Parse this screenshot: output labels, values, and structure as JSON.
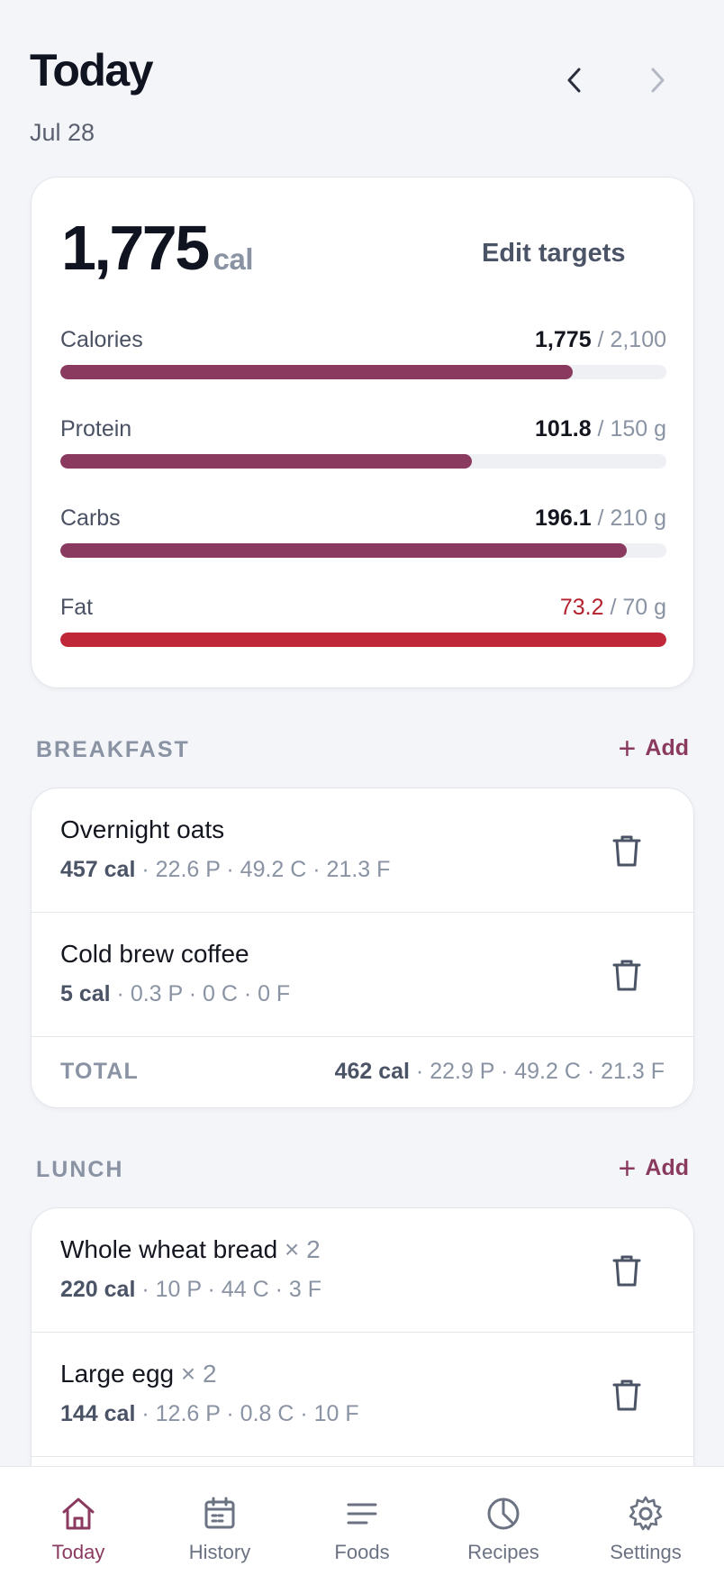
{
  "header": {
    "title": "Today",
    "date": "Jul 28"
  },
  "summary": {
    "calories_big": "1,775",
    "calories_unit": "cal",
    "edit_targets_label": "Edit targets",
    "macros": [
      {
        "label": "Calories",
        "current": "1,775",
        "target": "/ 2,100",
        "progress": 0.845,
        "over": false
      },
      {
        "label": "Protein",
        "current": "101.8",
        "target": "/ 150 g",
        "progress": 0.679,
        "over": false
      },
      {
        "label": "Carbs",
        "current": "196.1",
        "target": "/ 210 g",
        "progress": 0.934,
        "over": false
      },
      {
        "label": "Fat",
        "current": "73.2",
        "target": "/ 70 g",
        "progress": 1.0,
        "over": true
      }
    ]
  },
  "meals": {
    "breakfast": {
      "title": "BREAKFAST",
      "add_label": "Add",
      "items": [
        {
          "name": "Overnight oats",
          "qty": "",
          "cal": "457 cal",
          "macros": " · 22.6 P · 49.2 C · 21.3 F"
        },
        {
          "name": "Cold brew coffee",
          "qty": "",
          "cal": "5 cal",
          "macros": " · 0.3 P · 0 C · 0 F"
        }
      ],
      "total_label": "TOTAL",
      "total_cal": "462 cal",
      "total_macros": " · 22.9 P · 49.2 C · 21.3 F"
    },
    "lunch": {
      "title": "LUNCH",
      "add_label": "Add",
      "items": [
        {
          "name": "Whole wheat bread",
          "qty": " × 2",
          "cal": "220 cal",
          "macros": " · 10 P · 44 C · 3 F"
        },
        {
          "name": "Large egg",
          "qty": " × 2",
          "cal": "144 cal",
          "macros": " · 12.6 P · 0.8 C · 10 F"
        }
      ]
    }
  },
  "tabbar": {
    "tabs": [
      {
        "label": "Today",
        "icon": "home-icon",
        "active": true
      },
      {
        "label": "History",
        "icon": "calendar-icon",
        "active": false
      },
      {
        "label": "Foods",
        "icon": "list-icon",
        "active": false
      },
      {
        "label": "Recipes",
        "icon": "pie-chart-icon",
        "active": false
      },
      {
        "label": "Settings",
        "icon": "gear-icon",
        "active": false
      }
    ]
  },
  "colors": {
    "accent": "#8a3a5f",
    "over": "#c0283a",
    "background": "#f4f5f8"
  }
}
